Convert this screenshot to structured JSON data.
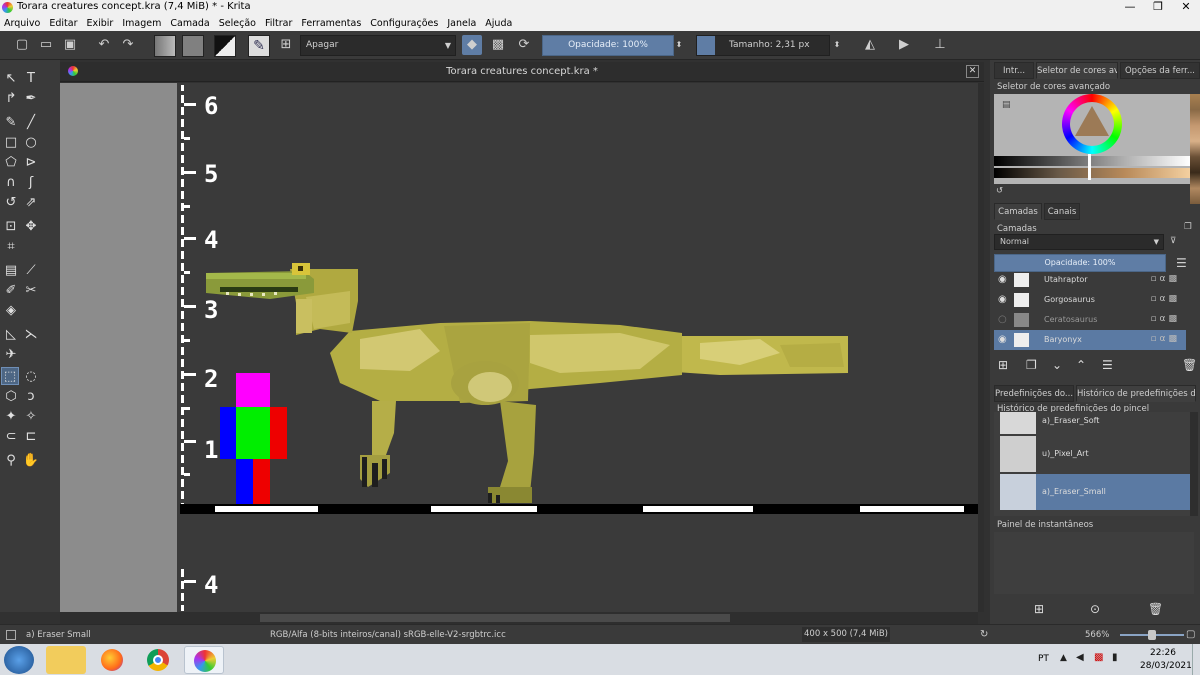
{
  "window": {
    "title": "Torara creatures concept.kra (7,4 MiB)  * - Krita",
    "minimize": "—",
    "maximize": "❐",
    "close": "✕"
  },
  "menu": [
    "Arquivo",
    "Editar",
    "Exibir",
    "Imagem",
    "Camada",
    "Seleção",
    "Filtrar",
    "Ferramentas",
    "Configurações",
    "Janela",
    "Ajuda"
  ],
  "toolbar": {
    "blend_mode": "Apagar",
    "opacity": "Opacidade: 100%",
    "size": "Tamanho: 2,31 px"
  },
  "document": {
    "tab_title": "Torara creatures concept.kra *",
    "ruler_numbers": [
      "6",
      "5",
      "4",
      "3",
      "2",
      "1",
      "4"
    ]
  },
  "dock": {
    "top_tabs": [
      "Intr...",
      "Seletor de cores av...",
      "Opções da ferr..."
    ],
    "color_panel_title": "Seletor de cores avançado",
    "layer_tabs": [
      "Camadas",
      "Canais"
    ],
    "layers_title": "Camadas",
    "layers_blend": "Normal",
    "layers_opacity": "Opacidade: 100%",
    "layers": [
      {
        "name": "Utahraptor",
        "visible": true,
        "active": false
      },
      {
        "name": "Gorgosaurus",
        "visible": true,
        "active": false
      },
      {
        "name": "Ceratosaurus",
        "visible": false,
        "active": false
      },
      {
        "name": "Baryonyx",
        "visible": true,
        "active": true
      }
    ],
    "preset_tabs": [
      "Predefinições do...",
      "Histórico de predefinições do ..."
    ],
    "preset_history_title": "Histórico de predefinições do pincel",
    "presets": [
      {
        "name": "a)_Eraser_Soft",
        "active": false
      },
      {
        "name": "u)_Pixel_Art",
        "active": false
      },
      {
        "name": "a)_Eraser_Small",
        "active": true
      }
    ],
    "snapshot_title": "Painel de instantâneos"
  },
  "statusbar": {
    "brush": "a) Eraser Small",
    "colorspace": "RGB/Alfa (8-bits inteiros/canal)  sRGB-elle-V2-srgbtrc.icc",
    "dimensions": "400 x 500 (7,4 MiB)",
    "zoom": "566%"
  },
  "taskbar": {
    "lang": "PT",
    "time": "22:26",
    "date": "28/03/2021"
  },
  "colors": {
    "accent": "#5b7aa3",
    "dino_base": "#b8b24a",
    "dino_light": "#d6ce72",
    "dino_dark": "#8a8a30"
  }
}
